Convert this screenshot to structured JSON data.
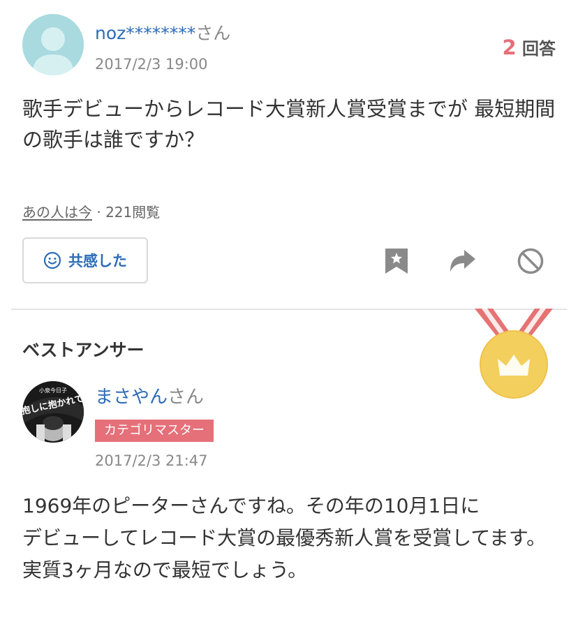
{
  "question": {
    "username": "noz********",
    "honorific": "さん",
    "date": "2017/2/3 19:00",
    "answer_count": "2",
    "answer_count_label": "回答",
    "text": "歌手デビューからレコード大賞新人賞受賞までが 最短期間の歌手は誰ですか？",
    "category": "あの人は今",
    "separator": " · ",
    "views": "221閲覧",
    "empathy_label": "共感した",
    "actions": [
      "bookmark-icon",
      "share-icon",
      "block-icon"
    ]
  },
  "best_answer": {
    "section_title": "ベストアンサー",
    "username": "まさやん",
    "honorific": "さん",
    "badge": "カテゴリマスター",
    "date": "2017/2/3 21:47",
    "avatar_text_top": "小泉今日子",
    "avatar_text_main": "抱しに抱かれて",
    "body": [
      "1969年のピーターさんですね。その年の10月1日に",
      "デビューしてレコード大賞の最優秀新人賞を受賞してます。",
      "実質3ヶ月なので最短でしょう。"
    ]
  },
  "colors": {
    "link": "#2d6bb5",
    "accent": "#e5707a",
    "medal_gold": "#f3cf5e",
    "ribbon": "#e57373",
    "avatar_bg": "#a8dadf"
  }
}
